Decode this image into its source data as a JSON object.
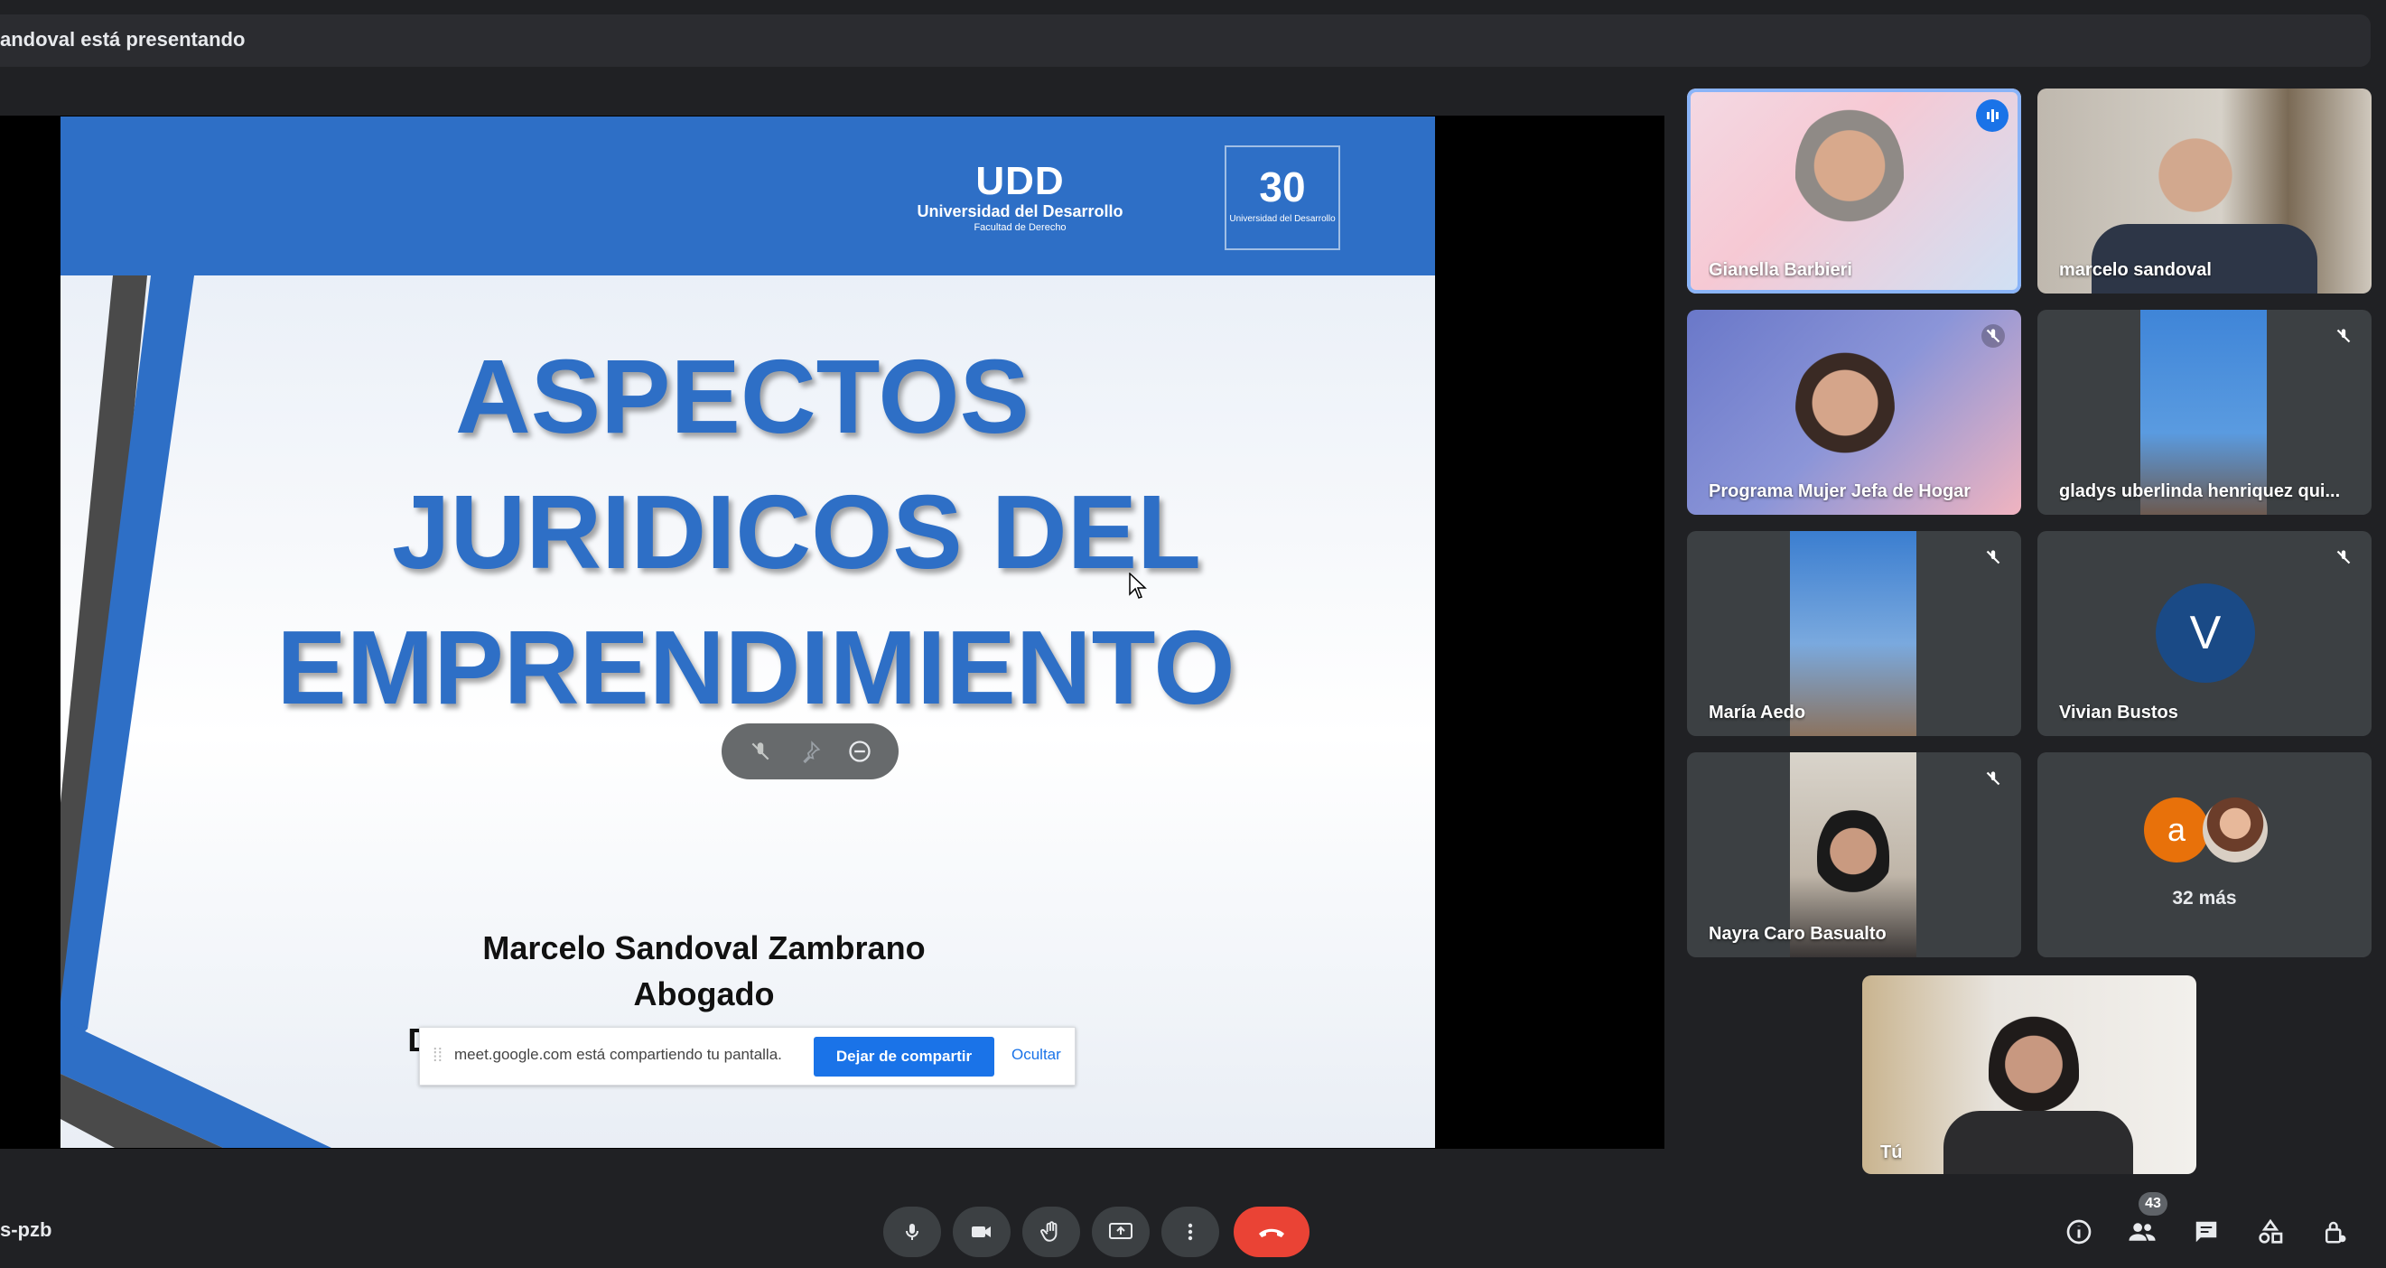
{
  "presenting_banner": "andoval está presentando",
  "slide": {
    "logo_mark": "UDD",
    "university": "Universidad del Desarrollo",
    "faculty": "Facultad de Derecho",
    "anniversary_number": "30",
    "anniversary_sub": "Universidad del Desarrollo",
    "title_lines": [
      "ASPECTOS",
      "JURIDICOS DEL",
      "EMPRENDIMIENTO"
    ],
    "author_lines": [
      "Marcelo Sandoval Zambrano",
      "Abogado",
      "Director Clínica Jurídica Derecho UDD"
    ]
  },
  "share_notice": {
    "text": "meet.google.com está compartiendo tu pantalla.",
    "stop_button": "Dejar de compartir",
    "hide_link": "Ocultar"
  },
  "participants": [
    {
      "name": "Gianella Barbieri",
      "state": "speaking"
    },
    {
      "name": "marcelo sandoval",
      "state": "unmuted"
    },
    {
      "name": "Programa Mujer Jefa de Hogar",
      "state": "muted"
    },
    {
      "name": "gladys uberlinda henriquez qui...",
      "state": "muted"
    },
    {
      "name": "María Aedo",
      "state": "muted"
    },
    {
      "name": "Vivian Bustos",
      "state": "muted",
      "avatar_letter": "V"
    },
    {
      "name": "Nayra Caro Basualto",
      "state": "muted"
    }
  ],
  "overflow_tile": {
    "avatar_letter": "a",
    "label": "32 más"
  },
  "self_tile": {
    "name": "Tú"
  },
  "bottom_bar": {
    "meeting_code": "s-pzb",
    "participants_count": "43",
    "controls": [
      "microphone-icon",
      "camera-icon",
      "raise-hand-icon",
      "present-screen-icon",
      "more-options-icon",
      "end-call-icon"
    ],
    "right_icons": [
      "info-icon",
      "people-icon",
      "chat-icon",
      "activities-icon",
      "host-controls-icon"
    ]
  },
  "colors": {
    "background": "#202124",
    "tile": "#3c4043",
    "accent": "#1a73e8",
    "end_call": "#ea4335",
    "slide_blue": "#2e6fc6"
  }
}
